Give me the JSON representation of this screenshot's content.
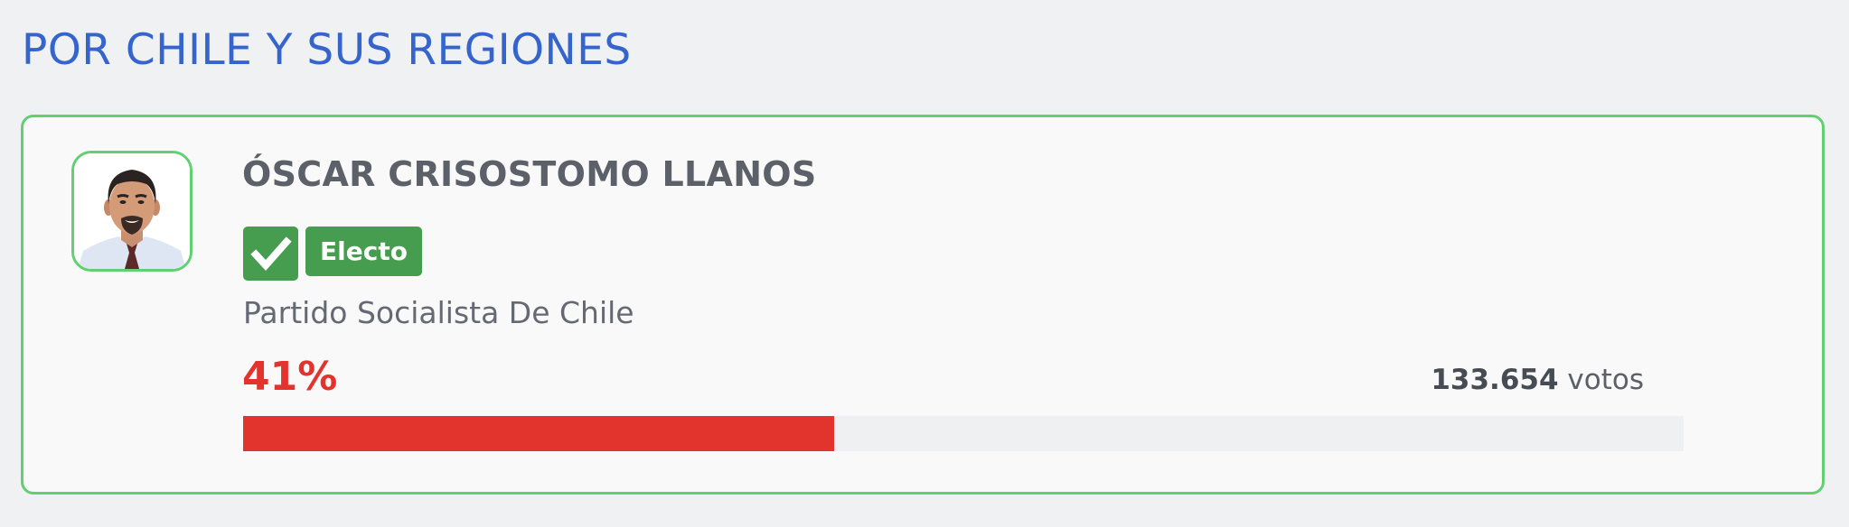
{
  "section": {
    "title": "POR CHILE Y SUS REGIONES"
  },
  "candidate": {
    "name": "ÓSCAR CRISOSTOMO LLANOS",
    "status_label": "Electo",
    "party": "Partido Socialista De Chile",
    "percent_label": "41%",
    "percent_value": 0.41,
    "votes_number": "133.654",
    "votes_unit": "votos",
    "status_icon": "checkmark-icon",
    "photo_icon": "candidate-photo"
  },
  "colors": {
    "title_blue": "#3565cc",
    "elected_green": "#479d4f",
    "card_border_green": "#62cf72",
    "percent_red": "#e3332d"
  }
}
